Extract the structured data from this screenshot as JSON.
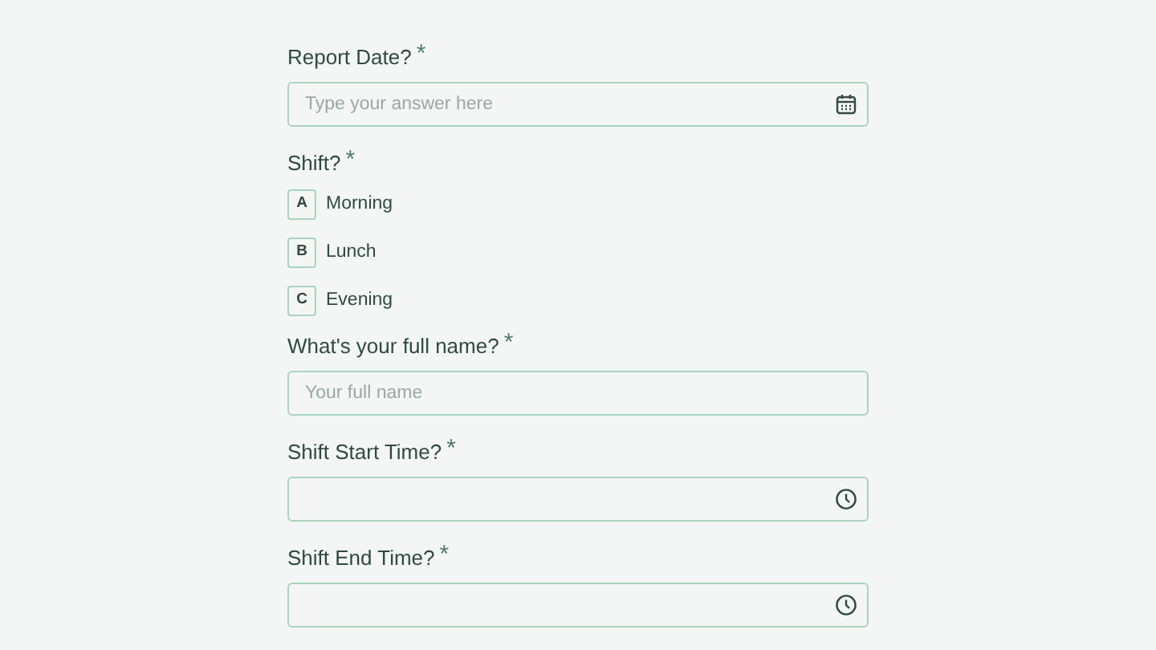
{
  "questions": [
    {
      "kind": "date",
      "label": "Report Date?",
      "required_mark": "*",
      "placeholder": "Type your answer here"
    },
    {
      "kind": "choice",
      "label": "Shift?",
      "required_mark": "*",
      "options": [
        {
          "key": "A",
          "label": "Morning",
          "selected": false
        },
        {
          "key": "B",
          "label": "Lunch",
          "selected": false
        },
        {
          "key": "C",
          "label": "Evening",
          "selected": false
        }
      ]
    },
    {
      "kind": "text",
      "label": "What's your full name?",
      "required_mark": "*",
      "placeholder": "Your full name"
    },
    {
      "kind": "time",
      "label": "Shift Start Time?",
      "required_mark": "*"
    },
    {
      "kind": "time",
      "label": "Shift End Time?",
      "required_mark": "*"
    }
  ]
}
